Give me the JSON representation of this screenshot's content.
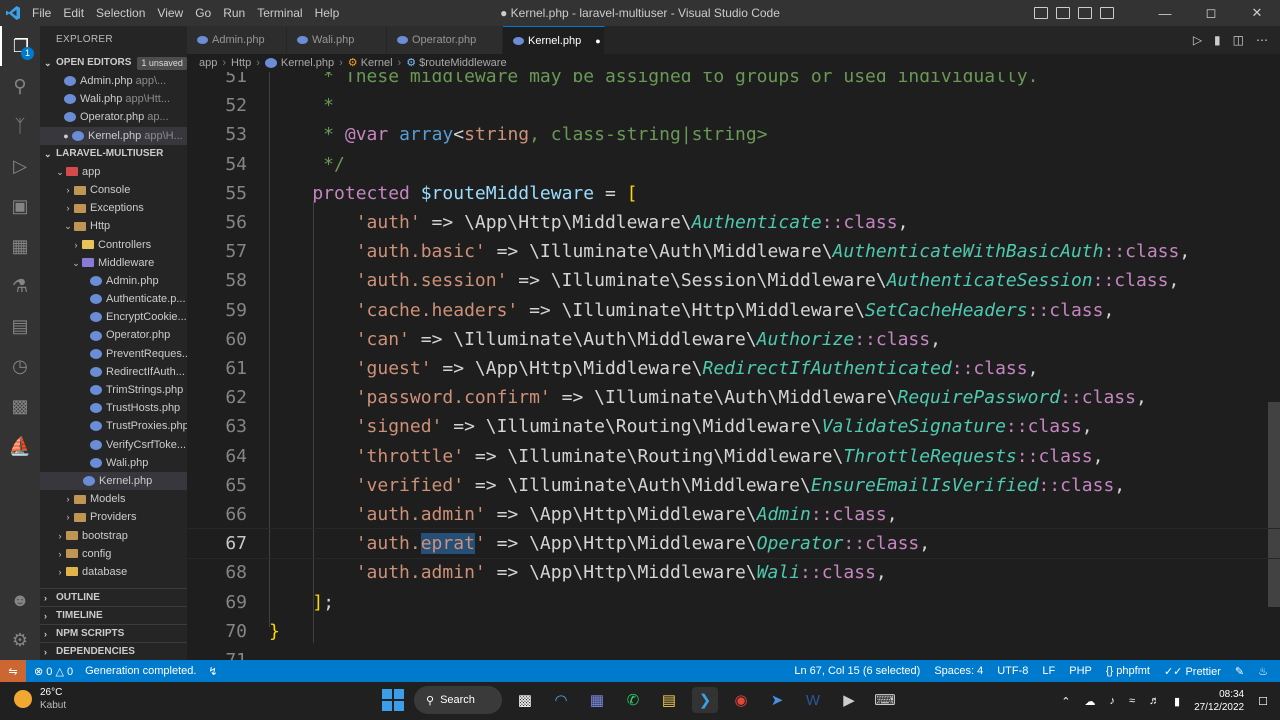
{
  "window": {
    "title": "● Kernel.php - laravel-multiuser - Visual Studio Code",
    "menu": [
      "File",
      "Edit",
      "Selection",
      "View",
      "Go",
      "Run",
      "Terminal",
      "Help"
    ]
  },
  "sidebar": {
    "header": "EXPLORER",
    "open_editors": {
      "label": "OPEN EDITORS",
      "badge": "1 unsaved",
      "items": [
        {
          "name": "Admin.php",
          "path": "app\\..."
        },
        {
          "name": "Wali.php",
          "path": "app\\Htt..."
        },
        {
          "name": "Operator.php",
          "path": "ap..."
        },
        {
          "name": "Kernel.php",
          "path": "app\\H..."
        }
      ]
    },
    "project": {
      "label": "LARAVEL-MULTIUSER",
      "app": "app",
      "console": "Console",
      "exceptions": "Exceptions",
      "http": "Http",
      "controllers": "Controllers",
      "middleware": "Middleware",
      "middleware_files": [
        "Admin.php",
        "Authenticate.p...",
        "EncryptCookie...",
        "Operator.php",
        "PreventReques...",
        "RedirectIfAuth...",
        "TrimStrings.php",
        "TrustHosts.php",
        "TrustProxies.php",
        "VerifyCsrfToke...",
        "Wali.php"
      ],
      "kernel": "Kernel.php",
      "models": "Models",
      "providers": "Providers",
      "bootstrap": "bootstrap",
      "config": "config",
      "database": "database"
    },
    "bottom_sections": [
      "OUTLINE",
      "TIMELINE",
      "NPM SCRIPTS",
      "DEPENDENCIES"
    ]
  },
  "tabs": [
    "Admin.php",
    "Wali.php",
    "Operator.php",
    "Kernel.php"
  ],
  "breadcrumb": [
    "app",
    "Http",
    "Kernel.php",
    "Kernel",
    "$routeMiddleware"
  ],
  "editor": {
    "lines": [
      {
        "n": "51",
        "parts": [
          [
            "cm",
            "     * These middleware may be assigned to groups or used individually."
          ]
        ]
      },
      {
        "n": "52",
        "parts": [
          [
            "cm",
            "     *"
          ]
        ]
      },
      {
        "n": "53",
        "parts": [
          [
            "cm",
            "     * "
          ],
          [
            "ph",
            "@var"
          ],
          [
            "cm",
            " "
          ],
          [
            "kw",
            "array"
          ],
          [
            "op",
            "<"
          ],
          [
            "st",
            "string"
          ],
          [
            "cm",
            ", class-string|string>"
          ]
        ]
      },
      {
        "n": "54",
        "parts": [
          [
            "cm",
            "     */"
          ]
        ]
      },
      {
        "n": "55",
        "parts": [
          [
            "ph",
            "    protected "
          ],
          [
            "vr",
            "$routeMiddleware"
          ],
          [
            "op",
            " = "
          ],
          [
            "br",
            "["
          ]
        ]
      },
      {
        "n": "56",
        "parts": [
          [
            "st",
            "        'auth'"
          ],
          [
            "op",
            " => \\App\\Http\\Middleware\\"
          ],
          [
            "cls",
            "Authenticate"
          ],
          [
            "cc",
            "::class"
          ],
          [
            "op",
            ","
          ]
        ]
      },
      {
        "n": "57",
        "parts": [
          [
            "st",
            "        'auth.basic'"
          ],
          [
            "op",
            " => \\Illuminate\\Auth\\Middleware\\"
          ],
          [
            "cls",
            "AuthenticateWithBasicAuth"
          ],
          [
            "cc",
            "::class"
          ],
          [
            "op",
            ","
          ]
        ]
      },
      {
        "n": "58",
        "parts": [
          [
            "st",
            "        'auth.session'"
          ],
          [
            "op",
            " => \\Illuminate\\Session\\Middleware\\"
          ],
          [
            "cls",
            "AuthenticateSession"
          ],
          [
            "cc",
            "::class"
          ],
          [
            "op",
            ","
          ]
        ]
      },
      {
        "n": "59",
        "parts": [
          [
            "st",
            "        'cache.headers'"
          ],
          [
            "op",
            " => \\Illuminate\\Http\\Middleware\\"
          ],
          [
            "cls",
            "SetCacheHeaders"
          ],
          [
            "cc",
            "::class"
          ],
          [
            "op",
            ","
          ]
        ]
      },
      {
        "n": "60",
        "parts": [
          [
            "st",
            "        'can'"
          ],
          [
            "op",
            " => \\Illuminate\\Auth\\Middleware\\"
          ],
          [
            "cls",
            "Authorize"
          ],
          [
            "cc",
            "::class"
          ],
          [
            "op",
            ","
          ]
        ]
      },
      {
        "n": "61",
        "parts": [
          [
            "st",
            "        'guest'"
          ],
          [
            "op",
            " => \\App\\Http\\Middleware\\"
          ],
          [
            "cls",
            "RedirectIfAuthenticated"
          ],
          [
            "cc",
            "::class"
          ],
          [
            "op",
            ","
          ]
        ]
      },
      {
        "n": "62",
        "parts": [
          [
            "st",
            "        'password.confirm'"
          ],
          [
            "op",
            " => \\Illuminate\\Auth\\Middleware\\"
          ],
          [
            "cls",
            "RequirePassword"
          ],
          [
            "cc",
            "::class"
          ],
          [
            "op",
            ","
          ]
        ]
      },
      {
        "n": "63",
        "parts": [
          [
            "st",
            "        'signed'"
          ],
          [
            "op",
            " => \\Illuminate\\Routing\\Middleware\\"
          ],
          [
            "cls",
            "ValidateSignature"
          ],
          [
            "cc",
            "::class"
          ],
          [
            "op",
            ","
          ]
        ]
      },
      {
        "n": "64",
        "parts": [
          [
            "st",
            "        'throttle'"
          ],
          [
            "op",
            " => \\Illuminate\\Routing\\Middleware\\"
          ],
          [
            "cls",
            "ThrottleRequests"
          ],
          [
            "cc",
            "::class"
          ],
          [
            "op",
            ","
          ]
        ]
      },
      {
        "n": "65",
        "parts": [
          [
            "st",
            "        'verified'"
          ],
          [
            "op",
            " => \\Illuminate\\Auth\\Middleware\\"
          ],
          [
            "cls",
            "EnsureEmailIsVerified"
          ],
          [
            "cc",
            "::class"
          ],
          [
            "op",
            ","
          ]
        ]
      },
      {
        "n": "66",
        "parts": [
          [
            "st",
            "        'auth.admin'"
          ],
          [
            "op",
            " => \\App\\Http\\Middleware\\"
          ],
          [
            "cls",
            "Admin"
          ],
          [
            "cc",
            "::class"
          ],
          [
            "op",
            ","
          ]
        ]
      },
      {
        "n": "67",
        "parts": [
          [
            "st",
            "        'auth."
          ],
          [
            "sel",
            "eprat"
          ],
          [
            "st",
            "'"
          ],
          [
            "op",
            " => \\App\\Http\\Middleware\\"
          ],
          [
            "cls",
            "Operator"
          ],
          [
            "cc",
            "::class"
          ],
          [
            "op",
            ","
          ]
        ]
      },
      {
        "n": "68",
        "parts": [
          [
            "st",
            "        'auth.admin'"
          ],
          [
            "op",
            " => \\App\\Http\\Middleware\\"
          ],
          [
            "cls",
            "Wali"
          ],
          [
            "cc",
            "::class"
          ],
          [
            "op",
            ","
          ]
        ]
      },
      {
        "n": "69",
        "parts": [
          [
            "br",
            "    ]"
          ],
          [
            "op",
            ";"
          ]
        ]
      },
      {
        "n": "70",
        "parts": [
          [
            "br",
            "}"
          ]
        ]
      },
      {
        "n": "71",
        "parts": [
          [
            "op",
            ""
          ]
        ]
      }
    ],
    "current_line": "67"
  },
  "status": {
    "errors": "0",
    "warnings": "0",
    "message": "Generation completed.",
    "position": "Ln 67, Col 15 (6 selected)",
    "spaces": "Spaces: 4",
    "encoding": "UTF-8",
    "eol": "LF",
    "language": "PHP",
    "formatter": "phpfmt",
    "prettier": "Prettier"
  },
  "taskbar": {
    "temperature": "26°C",
    "weather": "Kabut",
    "search": "Search",
    "time": "08:34",
    "date": "27/12/2022"
  },
  "colors": {
    "accent": "#007acc",
    "remote": "#cc6633"
  }
}
